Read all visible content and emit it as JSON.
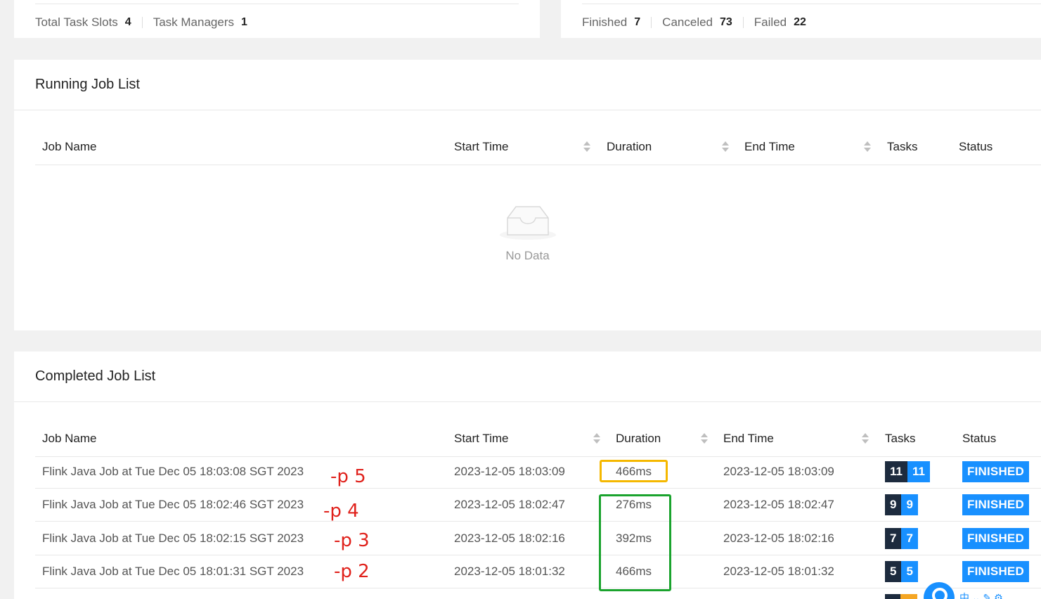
{
  "overview": {
    "total_task_slots_label": "Total Task Slots",
    "total_task_slots": "4",
    "task_managers_label": "Task Managers",
    "task_managers": "1",
    "finished_label": "Finished",
    "finished": "7",
    "canceled_label": "Canceled",
    "canceled": "73",
    "failed_label": "Failed",
    "failed": "22"
  },
  "running": {
    "title": "Running Job List",
    "columns": {
      "job_name": "Job Name",
      "start_time": "Start Time",
      "duration": "Duration",
      "end_time": "End Time",
      "tasks": "Tasks",
      "status": "Status"
    },
    "empty_text": "No Data"
  },
  "completed": {
    "title": "Completed Job List",
    "columns": {
      "job_name": "Job Name",
      "start_time": "Start Time",
      "duration": "Duration",
      "end_time": "End Time",
      "tasks": "Tasks",
      "status": "Status"
    },
    "rows": [
      {
        "name": "Flink Java Job at Tue Dec 05 18:03:08 SGT 2023",
        "start": "2023-12-05 18:03:09",
        "duration": "466ms",
        "end": "2023-12-05 18:03:09",
        "tasks_total": "11",
        "tasks_finished": "11",
        "status": "FINISHED"
      },
      {
        "name": "Flink Java Job at Tue Dec 05 18:02:46 SGT 2023",
        "start": "2023-12-05 18:02:47",
        "duration": "276ms",
        "end": "2023-12-05 18:02:47",
        "tasks_total": "9",
        "tasks_finished": "9",
        "status": "FINISHED"
      },
      {
        "name": "Flink Java Job at Tue Dec 05 18:02:15 SGT 2023",
        "start": "2023-12-05 18:02:16",
        "duration": "392ms",
        "end": "2023-12-05 18:02:16",
        "tasks_total": "7",
        "tasks_finished": "7",
        "status": "FINISHED"
      },
      {
        "name": "Flink Java Job at Tue Dec 05 18:01:31 SGT 2023",
        "start": "2023-12-05 18:01:32",
        "duration": "466ms",
        "end": "2023-12-05 18:01:32",
        "tasks_total": "5",
        "tasks_finished": "5",
        "status": "FINISHED"
      }
    ]
  },
  "annotations": [
    "-p 5",
    "-p 4",
    "-p 3",
    "-p 2"
  ],
  "tray_text": "中 ⌄ ✎ ⚙"
}
